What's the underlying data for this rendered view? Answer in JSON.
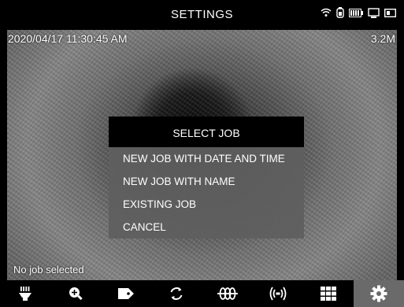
{
  "header": {
    "title": "SETTINGS"
  },
  "status_icons": [
    "wifi-icon",
    "battery-indicator-icon",
    "battery-icon",
    "monitor-icon",
    "card-icon"
  ],
  "overlay": {
    "datetime": "2020/04/17 11:30:45 AM",
    "resolution": "3.2M",
    "job_status": "No job selected"
  },
  "dialog": {
    "title": "SELECT JOB",
    "options": [
      "NEW JOB WITH DATE AND TIME",
      "NEW JOB WITH NAME",
      "EXISTING JOB",
      "CANCEL"
    ]
  },
  "toolbar": {
    "tools": [
      "light-icon",
      "zoom-in-icon",
      "tag-icon",
      "rotate-icon",
      "coil-icon",
      "sonde-icon",
      "grid-icon",
      "settings-icon"
    ],
    "active": "settings-icon"
  },
  "colors": {
    "dialog_bg": "#5f5f5f",
    "header_bg": "#000000",
    "active_tool_bg": "#6a6a6a"
  }
}
